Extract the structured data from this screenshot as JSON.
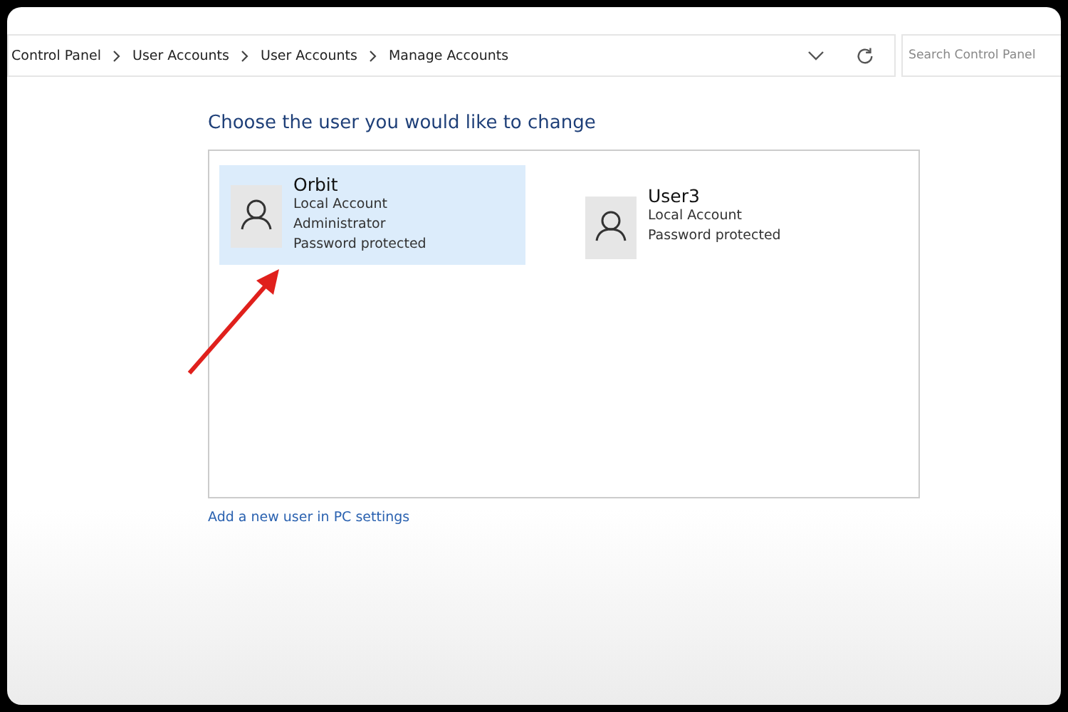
{
  "address_bar": {
    "breadcrumbs": [
      "Control Panel",
      "User Accounts",
      "User Accounts",
      "Manage Accounts"
    ]
  },
  "search": {
    "placeholder": "Search Control Panel"
  },
  "heading": "Choose the user you would like to change",
  "accounts": [
    {
      "name": "Orbit",
      "details": [
        "Local Account",
        "Administrator",
        "Password protected"
      ],
      "selected": true
    },
    {
      "name": "User3",
      "details": [
        "Local Account",
        "Password protected"
      ],
      "selected": false
    }
  ],
  "link": "Add a new user in PC settings"
}
